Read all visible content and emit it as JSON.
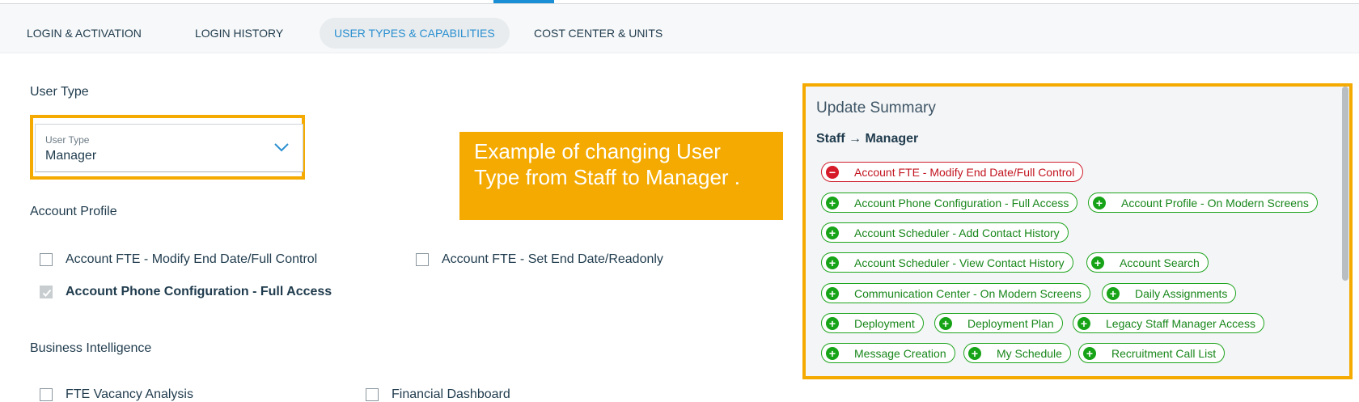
{
  "tabs": [
    {
      "label": "LOGIN & ACTIVATION",
      "active": false
    },
    {
      "label": "LOGIN HISTORY",
      "active": false
    },
    {
      "label": "USER TYPES & CAPABILITIES",
      "active": true
    },
    {
      "label": "COST CENTER & UNITS",
      "active": false
    }
  ],
  "user_type": {
    "section_title": "User Type",
    "field_label": "User Type",
    "value": "Manager"
  },
  "callout": {
    "text": "Example of changing User Type from Staff to Manager ."
  },
  "account_profile": {
    "title": "Account Profile",
    "items": [
      {
        "label": "Account FTE - Modify End Date/Full Control",
        "checked": false
      },
      {
        "label": "Account FTE - Set End Date/Readonly",
        "checked": false
      },
      {
        "label": "Account Phone Configuration - Full Access",
        "checked": true
      }
    ]
  },
  "business_intelligence": {
    "title": "Business Intelligence",
    "items": [
      {
        "label": "FTE Vacancy Analysis",
        "checked": false
      },
      {
        "label": "Financial Dashboard",
        "checked": false
      }
    ]
  },
  "summary": {
    "title": "Update Summary",
    "transition": "Staff → Manager",
    "changes": [
      {
        "label": "Account FTE - Modify End Date/Full Control",
        "type": "removed",
        "icon": "minus-circle-icon"
      },
      {
        "label": "Account Phone Configuration - Full Access",
        "type": "added",
        "icon": "plus-circle-icon"
      },
      {
        "label": "Account Profile - On Modern Screens",
        "type": "added",
        "icon": "plus-circle-icon"
      },
      {
        "label": "Account Scheduler - Add Contact History",
        "type": "added",
        "icon": "plus-circle-icon"
      },
      {
        "label": "Account Scheduler - View Contact History",
        "type": "added",
        "icon": "plus-circle-icon"
      },
      {
        "label": "Account Search",
        "type": "added",
        "icon": "plus-circle-icon"
      },
      {
        "label": "Communication Center - On Modern Screens",
        "type": "added",
        "icon": "plus-circle-icon"
      },
      {
        "label": "Daily Assignments",
        "type": "added",
        "icon": "plus-circle-icon"
      },
      {
        "label": "Deployment",
        "type": "added",
        "icon": "plus-circle-icon"
      },
      {
        "label": "Deployment Plan",
        "type": "added",
        "icon": "plus-circle-icon"
      },
      {
        "label": "Legacy Staff Manager Access",
        "type": "added",
        "icon": "plus-circle-icon"
      },
      {
        "label": "Message Creation",
        "type": "added",
        "icon": "plus-circle-icon"
      },
      {
        "label": "My Schedule",
        "type": "added",
        "icon": "plus-circle-icon"
      },
      {
        "label": "Recruitment Call List",
        "type": "added",
        "icon": "plus-circle-icon"
      }
    ]
  },
  "colors": {
    "accent": "#2a8fd0",
    "callout": "#f4aa00",
    "added": "#18871a",
    "removed": "#c2141f"
  }
}
